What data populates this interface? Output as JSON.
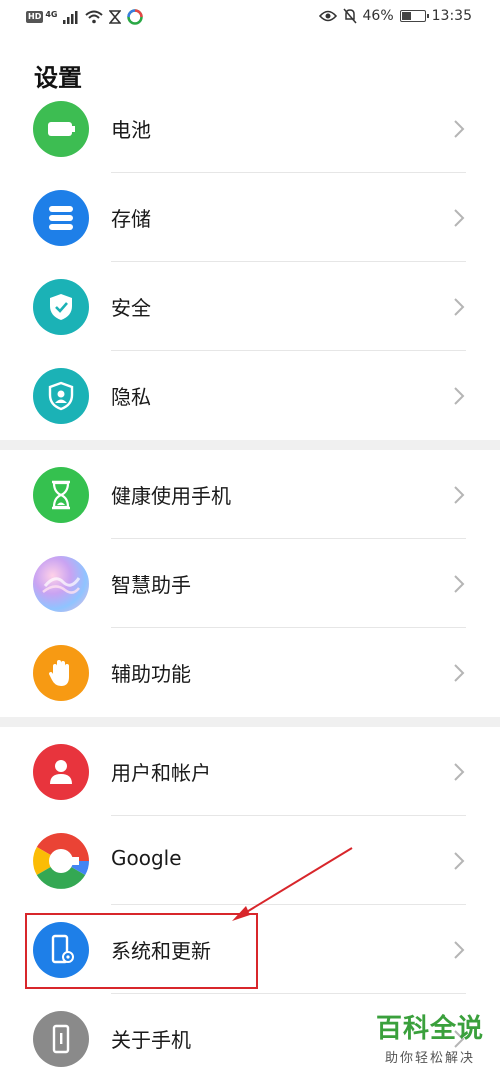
{
  "status_bar": {
    "hd": "HD",
    "network": "4G",
    "battery_text": "46%",
    "battery_level": 0.46,
    "time": "13:35"
  },
  "page": {
    "title": "设置"
  },
  "items": [
    {
      "label": "电池",
      "icon": "battery-icon",
      "color": "#3dbd52"
    },
    {
      "label": "存储",
      "icon": "storage-icon",
      "color": "#1e7fe8"
    },
    {
      "label": "安全",
      "icon": "shield-check-icon",
      "color": "#1bb2b6"
    },
    {
      "label": "隐私",
      "icon": "privacy-icon",
      "color": "#1bb2b6"
    },
    {
      "label": "健康使用手机",
      "icon": "hourglass-icon",
      "color": "#35c14f"
    },
    {
      "label": "智慧助手",
      "icon": "assistant-icon",
      "color": "#c79cf0"
    },
    {
      "label": "辅助功能",
      "icon": "hand-icon",
      "color": "#f79a13"
    },
    {
      "label": "用户和帐户",
      "icon": "user-icon",
      "color": "#e8343d"
    },
    {
      "label": "Google",
      "icon": "google-icon",
      "color": "#ffffff"
    },
    {
      "label": "系统和更新",
      "icon": "system-update-icon",
      "color": "#1e7fe8"
    },
    {
      "label": "关于手机",
      "icon": "phone-info-icon",
      "color": "#8a8a8a"
    }
  ],
  "watermark": {
    "title": "百科全说",
    "subtitle": "助你轻松解决"
  },
  "colors": {
    "annotation": "#d8262b",
    "separator": "#f0f0f0"
  }
}
